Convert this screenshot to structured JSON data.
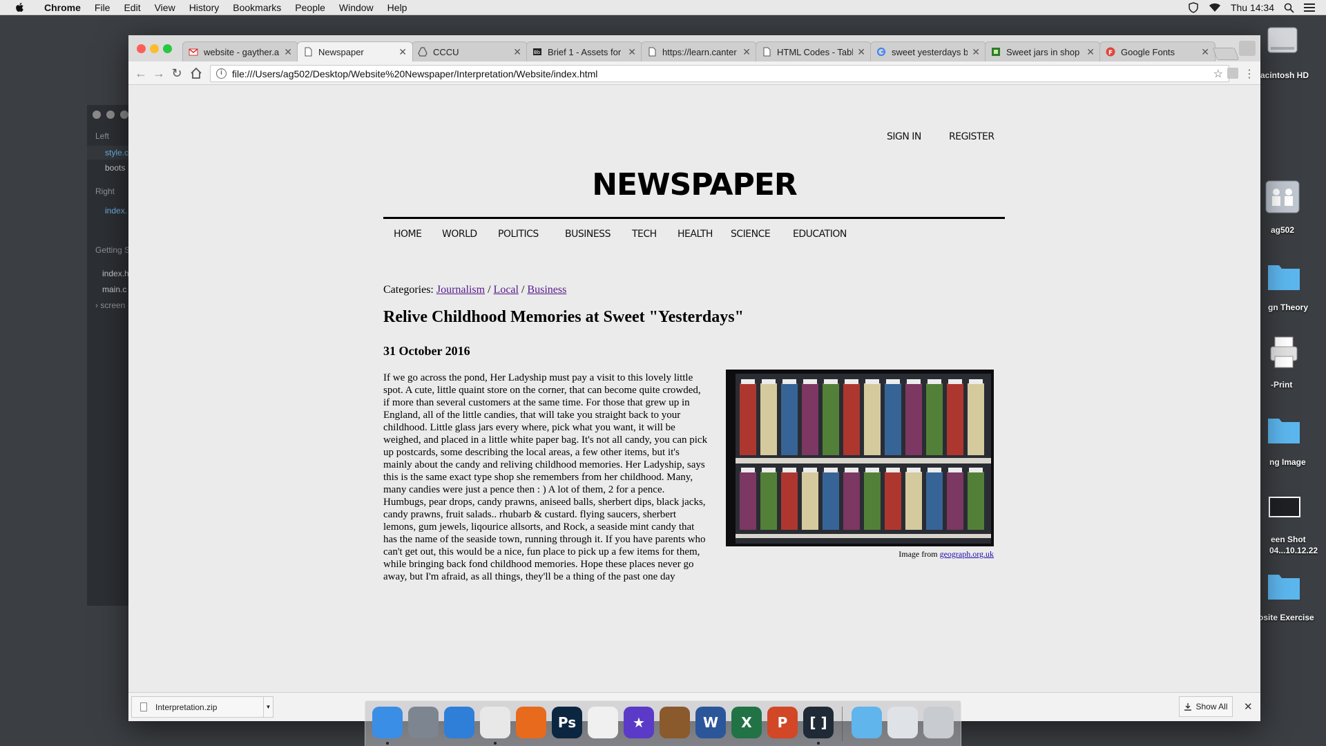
{
  "menubar": {
    "app_name": "Chrome",
    "items": [
      "File",
      "Edit",
      "View",
      "History",
      "Bookmarks",
      "People",
      "Window",
      "Help"
    ],
    "clock": "Thu 14:34"
  },
  "background_window": {
    "sections": [
      {
        "label": "Left"
      },
      {
        "label": "style.c"
      },
      {
        "label": "boots"
      },
      {
        "label": "Right"
      },
      {
        "label": "index."
      },
      {
        "label": "Getting S"
      },
      {
        "label": "index.h"
      },
      {
        "label": "main.c"
      },
      {
        "label": "› screen"
      }
    ]
  },
  "desktop": {
    "items": [
      {
        "label": "acintosh HD",
        "icon": "hard-drive-icon"
      },
      {
        "label": "ag502",
        "icon": "network-users-icon"
      },
      {
        "label": "gn Theory",
        "icon": "folder-icon"
      },
      {
        "label": "-Print",
        "icon": "printer-icon"
      },
      {
        "label": "ng Image",
        "icon": "folder-icon"
      },
      {
        "label": "een Shot",
        "label2": "04...10.12.22",
        "icon": "screenshot-icon"
      },
      {
        "label": "osite Exercise",
        "icon": "folder-icon"
      }
    ]
  },
  "browser": {
    "tabs": [
      {
        "title": "website - gayther.a",
        "favicon": "gmail-icon",
        "active": false
      },
      {
        "title": "Newspaper",
        "favicon": "page-icon",
        "active": true
      },
      {
        "title": "CCCU",
        "favicon": "drive-icon",
        "active": false
      },
      {
        "title": "Brief 1 - Assets for",
        "favicon": "bb-icon",
        "active": false
      },
      {
        "title": "https://learn.canter",
        "favicon": "page-icon",
        "active": false
      },
      {
        "title": "HTML Codes - Tabl",
        "favicon": "page-icon",
        "active": false
      },
      {
        "title": "sweet yesterdays b",
        "favicon": "google-icon",
        "active": false
      },
      {
        "title": "Sweet jars in shop",
        "favicon": "geograph-icon",
        "active": false
      },
      {
        "title": "Google Fonts",
        "favicon": "google-fonts-icon",
        "active": false
      }
    ],
    "url": "file:///Users/ag502/Desktop/Website%20Newspaper/Interpretation/Website/index.html"
  },
  "site": {
    "top_links": {
      "sign_in": "SIGN IN",
      "register": "REGISTER"
    },
    "logo": "NEWSPAPER",
    "nav": [
      "HOME",
      "WORLD",
      "POLITICS",
      "BUSINESS",
      "TECH",
      "HEALTH",
      "SCIENCE",
      "EDUCATION"
    ],
    "article": {
      "categories_label": "Categories:",
      "categories": [
        "Journalism",
        "Local",
        "Business"
      ],
      "separator": " / ",
      "headline": "Relive Childhood Memories at Sweet \"Yesterdays\"",
      "date": "31 October 2016",
      "body": "If we go across the pond, Her Ladyship must pay a visit to this lovely little spot. A cute, little quaint store on the corner, that can become quite crowded, if more than several customers at the same time. For those that grew up in England, all of the little candies, that will take you straight back to your childhood. Little glass jars every where, pick what you want, it will be weighed, and placed in a little white paper bag. It's not all candy, you can pick up postcards, some describing the local areas, a few other items, but it's mainly about the candy and reliving childhood memories. Her Ladyship, says this is the same exact type shop she remembers from her childhood. Many, many candies were just a pence then : ) A lot of them, 2 for a pence. Humbugs, pear drops, candy prawns, aniseed balls, sherbert dips, black jacks, candy prawns, fruit salads.. rhubarb & custard. flying saucers, sherbert lemons, gum jewels, liqourice allsorts, and Rock, a seaside mint candy that has the name of the seaside town, running through it. If you have parents who can't get out, this would be a nice, fun place to pick up a few items for them, while bringing back fond childhood memories. Hope these places never go away, but I'm afraid, as all things, they'll be a thing of the past one day",
      "image_credit_prefix": "Image from ",
      "image_credit_link": "geograph.org.uk"
    }
  },
  "downloads": {
    "file": "Interpretation.zip",
    "show_all": "Show All"
  },
  "dock": {
    "apps": [
      {
        "name": "finder-icon",
        "glyph": "",
        "color": "#3a8ee6",
        "running": true
      },
      {
        "name": "launchpad-icon",
        "glyph": "",
        "color": "#7d8590",
        "running": false
      },
      {
        "name": "safari-icon",
        "glyph": "",
        "color": "#2f7fd8",
        "running": false
      },
      {
        "name": "chrome-icon",
        "glyph": "",
        "color": "#e8e8e8",
        "running": true
      },
      {
        "name": "firefox-icon",
        "glyph": "",
        "color": "#e86a1c",
        "running": false
      },
      {
        "name": "photoshop-icon",
        "glyph": "Ps",
        "color": "#0b2640",
        "running": false
      },
      {
        "name": "photos-icon",
        "glyph": "",
        "color": "#f0f0f0",
        "running": false
      },
      {
        "name": "imovie-icon",
        "glyph": "★",
        "color": "#5b3ac8",
        "running": false
      },
      {
        "name": "garageband-icon",
        "glyph": "",
        "color": "#8a5a2c",
        "running": false
      },
      {
        "name": "word-icon",
        "glyph": "W",
        "color": "#2b579a",
        "running": false
      },
      {
        "name": "excel-icon",
        "glyph": "X",
        "color": "#217346",
        "running": false
      },
      {
        "name": "powerpoint-icon",
        "glyph": "P",
        "color": "#d24726",
        "running": false
      },
      {
        "name": "brackets-icon",
        "glyph": "[ ]",
        "color": "#1f2a36",
        "running": true
      },
      {
        "name": "folder-icon",
        "glyph": "",
        "color": "#5fb5ec",
        "running": false
      },
      {
        "name": "downloads-stack-icon",
        "glyph": "",
        "color": "#dfe3e8",
        "running": false
      },
      {
        "name": "trash-icon",
        "glyph": "",
        "color": "#c8cbd0",
        "running": false
      }
    ]
  }
}
